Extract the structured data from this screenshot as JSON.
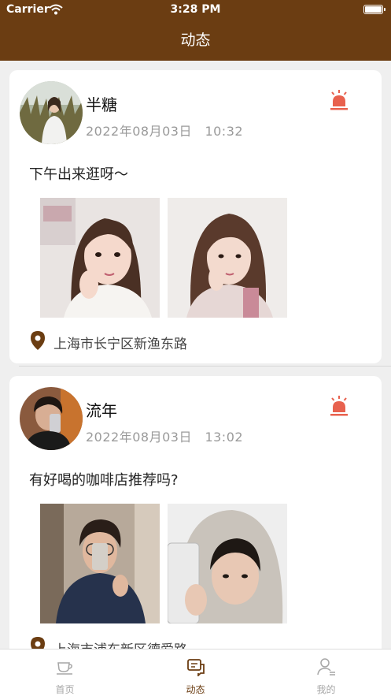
{
  "status_bar": {
    "carrier": "Carrier",
    "time": "3:28 PM"
  },
  "nav": {
    "title": "动态"
  },
  "posts": [
    {
      "name": "半糖",
      "time": "2022年08月03日　10:32",
      "content": "下午出来逛呀～",
      "location": "上海市长宁区新渔东路"
    },
    {
      "name": "流年",
      "time": "2022年08月03日　13:02",
      "content": "有好喝的咖啡店推荐吗?",
      "location": "上海市浦东新区德爱路"
    }
  ],
  "tabs": [
    {
      "label": "首页",
      "icon": "coffee-cup-icon"
    },
    {
      "label": "动态",
      "icon": "chat-icon"
    },
    {
      "label": "我的",
      "icon": "person-icon"
    }
  ],
  "colors": {
    "brand": "#6b3d12",
    "alarm": "#e8614e"
  }
}
